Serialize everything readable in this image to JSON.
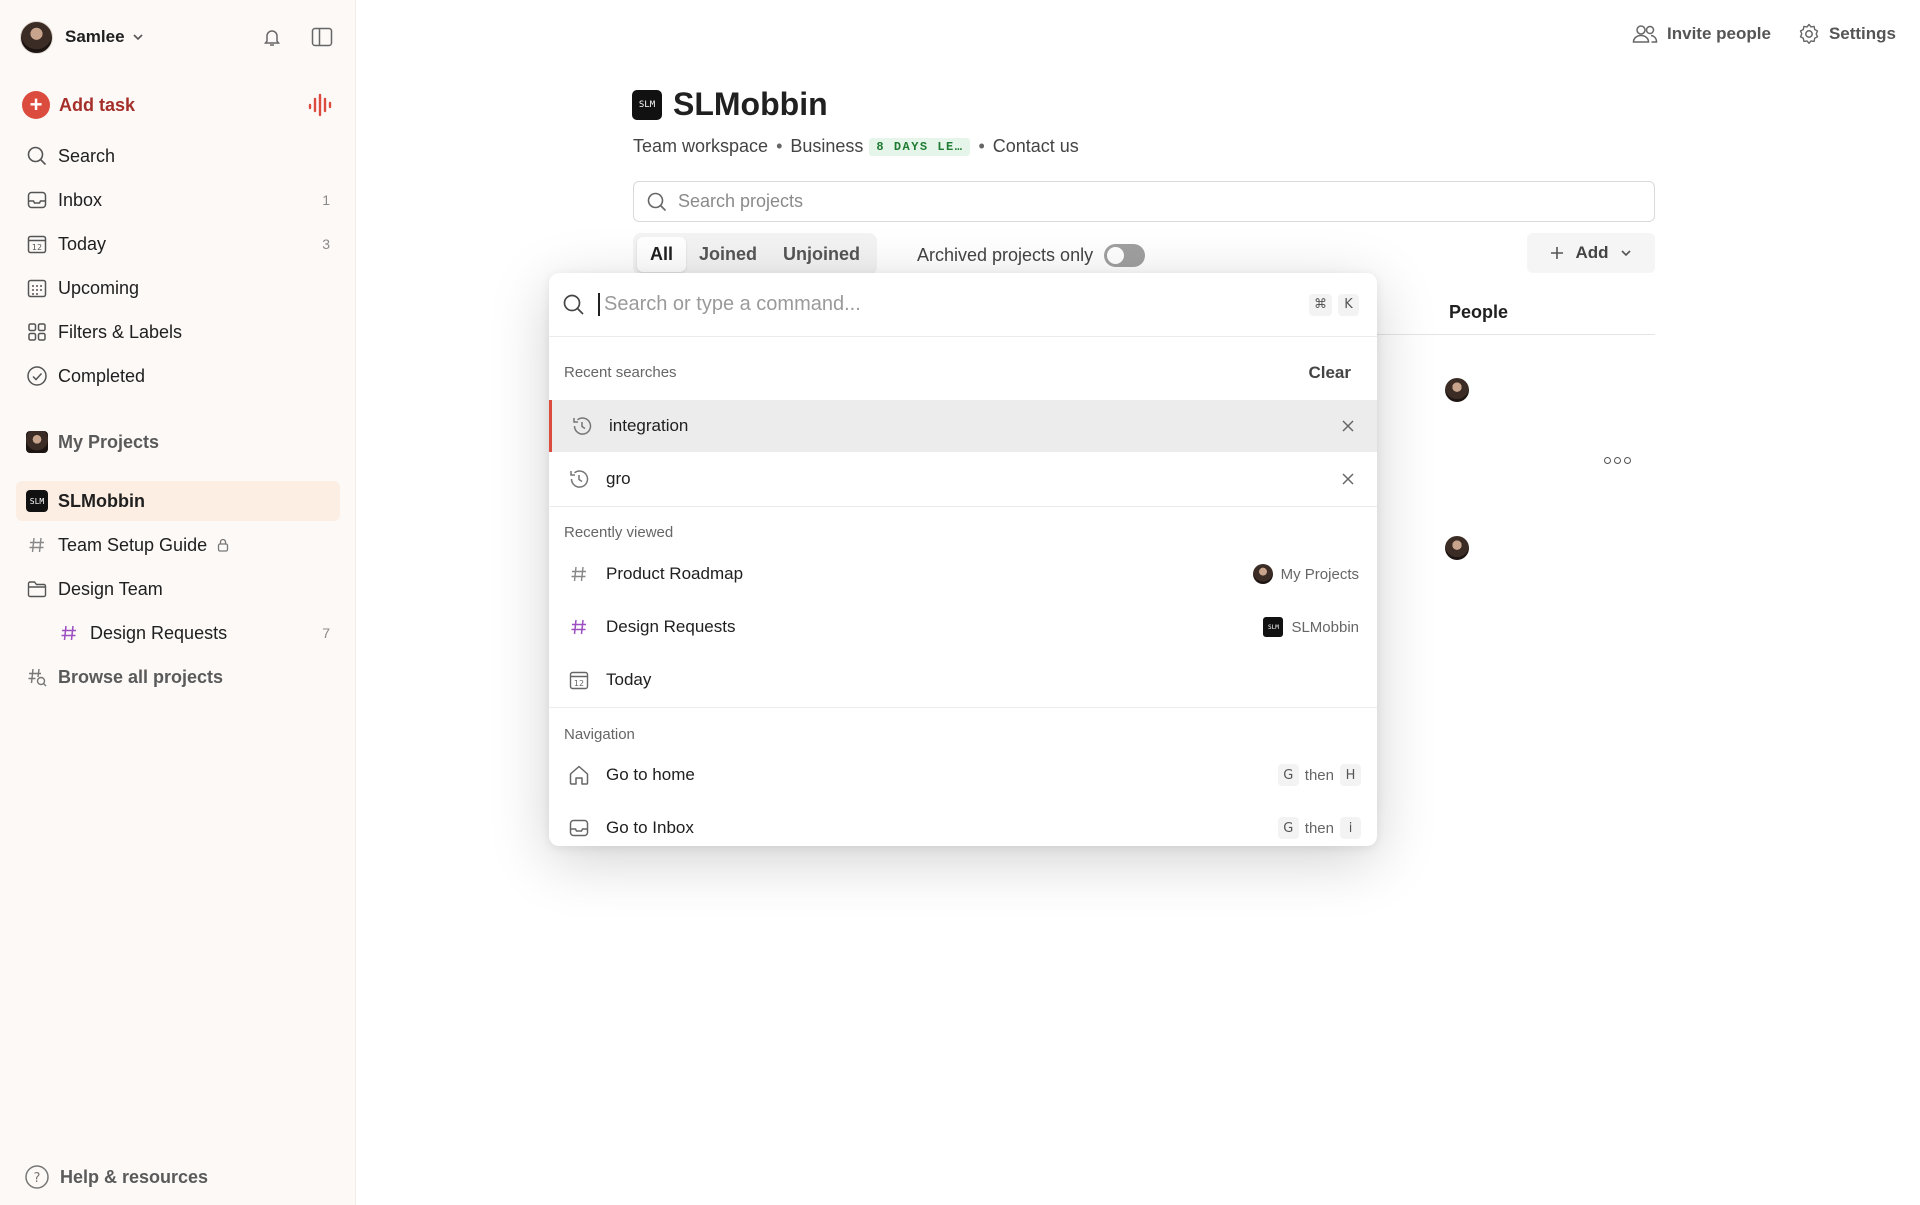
{
  "sidebar": {
    "user_name": "Samlee",
    "add_task": "Add task",
    "nav": [
      {
        "label": "Search",
        "count": ""
      },
      {
        "label": "Inbox",
        "count": "1"
      },
      {
        "label": "Today",
        "count": "3"
      },
      {
        "label": "Upcoming",
        "count": ""
      },
      {
        "label": "Filters & Labels",
        "count": ""
      },
      {
        "label": "Completed",
        "count": ""
      }
    ],
    "my_projects": "My Projects",
    "workspace": "SLMobbin",
    "projects": [
      {
        "label": "Team Setup Guide",
        "count": ""
      },
      {
        "label": "Design Team",
        "count": ""
      },
      {
        "label": "Design Requests",
        "count": "7"
      },
      {
        "label": "Browse all projects",
        "count": ""
      }
    ],
    "help": "Help & resources"
  },
  "topbar": {
    "invite": "Invite people",
    "settings": "Settings"
  },
  "workspace": {
    "logo_text": "SLM",
    "title": "SLMobbin",
    "type": "Team workspace",
    "plan": "Business",
    "trial_badge": "8 DAYS LE…",
    "contact": "Contact us",
    "search_placeholder": "Search projects",
    "tabs": [
      "All",
      "Joined",
      "Unjoined"
    ],
    "archived_label": "Archived projects only",
    "archived_on": false,
    "add_label": "Add",
    "people_header": "People"
  },
  "palette": {
    "placeholder": "Search or type a command...",
    "shortcut": [
      "⌘",
      "K"
    ],
    "recent_header": "Recent searches",
    "clear": "Clear",
    "recent": [
      "integration",
      "gro"
    ],
    "viewed_header": "Recently viewed",
    "viewed": [
      {
        "label": "Product Roadmap",
        "context": "My Projects"
      },
      {
        "label": "Design Requests",
        "context": "SLMobbin"
      },
      {
        "label": "Today",
        "context": ""
      }
    ],
    "nav_header": "Navigation",
    "navigation": [
      {
        "label": "Go to home",
        "key1": "G",
        "then": "then",
        "key2": "H"
      },
      {
        "label": "Go to Inbox",
        "key1": "G",
        "then": "then",
        "key2": "i"
      }
    ]
  },
  "colors": {
    "accent": "#dc4c3e",
    "active_bg": "#fdeee3",
    "trial_green": "#1d7b32"
  }
}
